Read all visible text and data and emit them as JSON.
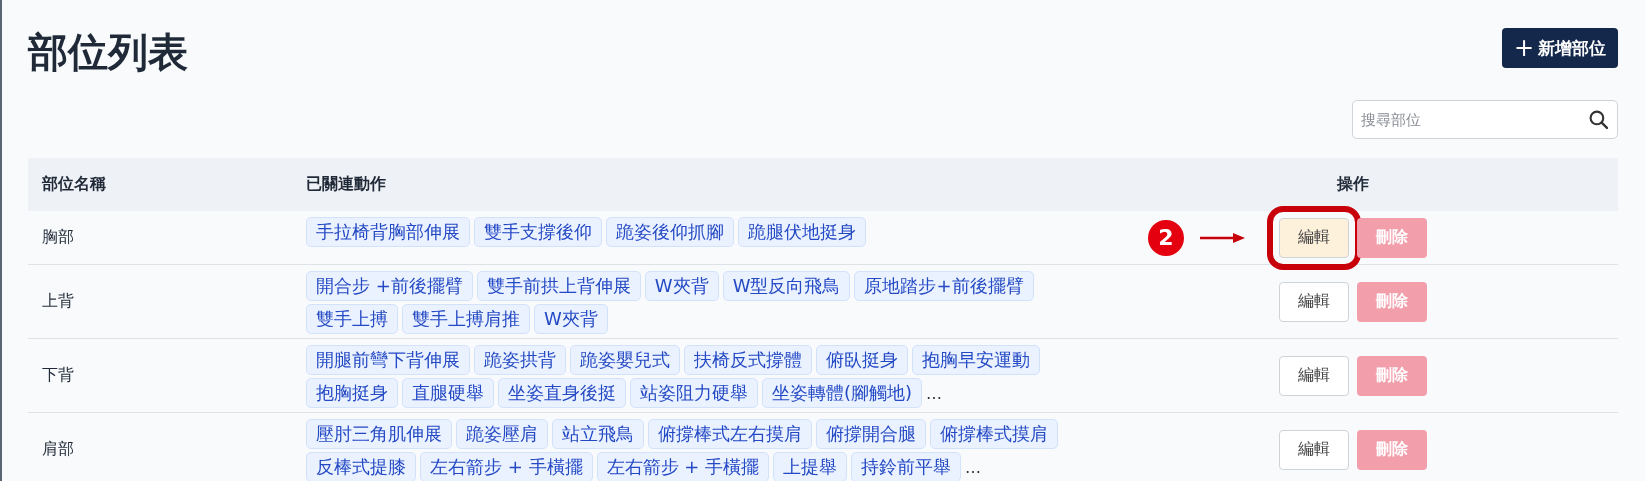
{
  "title": "部位列表",
  "add_button": {
    "icon": "+",
    "label": "新增部位"
  },
  "search": {
    "placeholder": "搜尋部位"
  },
  "table": {
    "columns": [
      "部位名稱",
      "已關連動作",
      "操作"
    ],
    "rows": [
      {
        "name": "胸部",
        "actions": [
          "手拉椅背胸部伸展",
          "雙手支撐後仰",
          "跪姿後仰抓腳",
          "跪腿伏地挺身"
        ],
        "more": "",
        "edit": "編輯",
        "delete": "刪除",
        "highlighted": true,
        "callout": "2"
      },
      {
        "name": "上背",
        "actions": [
          "開合步 +前後擺臂",
          "雙手前拱上背伸展",
          "W夾背",
          "W型反向飛鳥",
          "原地踏步+前後擺臂",
          "雙手上搏",
          "雙手上搏肩推",
          "W夾背"
        ],
        "more": "",
        "edit": "編輯",
        "delete": "刪除",
        "highlighted": false,
        "callout": ""
      },
      {
        "name": "下背",
        "actions": [
          "開腿前彎下背伸展",
          "跪姿拱背",
          "跪姿嬰兒式",
          "扶椅反式撐體",
          "俯臥挺身",
          "抱胸早安運動",
          "抱胸挺身",
          "直腿硬舉",
          "坐姿直身後挺",
          "站姿阻力硬舉",
          "坐姿轉體(腳觸地)"
        ],
        "more": "…",
        "edit": "編輯",
        "delete": "刪除",
        "highlighted": false,
        "callout": ""
      },
      {
        "name": "肩部",
        "actions": [
          "壓肘三角肌伸展",
          "跪姿壓肩",
          "站立飛鳥",
          "俯撐棒式左右摸肩",
          "俯撐開合腿",
          "俯撐棒式摸肩",
          "反棒式提膝",
          "左右箭步 + 手橫擺",
          "左右箭步 + 手橫擺",
          "上提舉",
          "持鈴前平舉"
        ],
        "more": "…",
        "edit": "編輯",
        "delete": "刪除",
        "highlighted": false,
        "callout": ""
      }
    ]
  }
}
